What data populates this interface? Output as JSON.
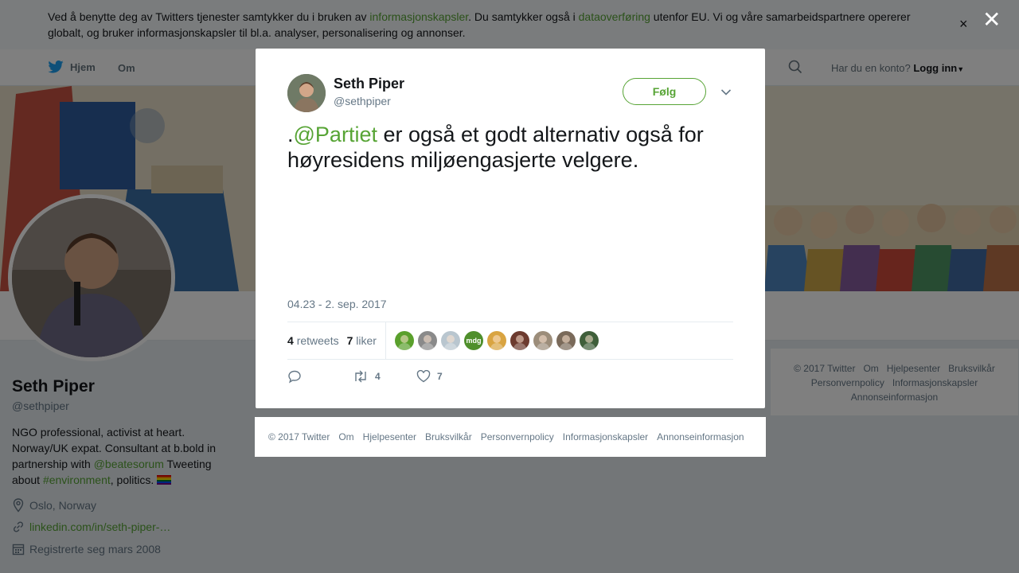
{
  "cookie": {
    "text_1": "Ved å benytte deg av Twitters tjenester samtykker du i bruken av ",
    "link_1": "informasjonskapsler",
    "text_2": ". Du samtykker også i ",
    "link_2": "dataoverføring",
    "text_3": " utenfor EU. Vi og våre samarbeidspartnere opererer globalt, og bruker informasjonskapsler til bl.a. analyser, personalisering og annonser.",
    "close": "×"
  },
  "nav": {
    "home": "Hjem",
    "about": "Om",
    "login_prompt": "Har du en konto?",
    "login": "Logg inn"
  },
  "profile": {
    "name": "Seth Piper",
    "handle": "@sethpiper",
    "bio_1": "NGO professional, activist at heart. Norway/UK expat. Consultant at b.bold in partnership with ",
    "bio_mention": "@beatesorum",
    "bio_2": " Tweeting about ",
    "bio_hashtag": "#environment",
    "bio_3": ", politics. ",
    "location": "Oslo, Norway",
    "website": "linkedin.com/in/seth-piper-…",
    "joined": "Registrerte seg mars 2008"
  },
  "bg_footer": {
    "items": [
      "© 2017 Twitter",
      "Om",
      "Hjelpesenter",
      "Bruksvilkår",
      "Personvernpolicy",
      "Informasjonskapsler",
      "Annonseinformasjon"
    ]
  },
  "overlay": {
    "close": "✕"
  },
  "tweet": {
    "name": "Seth Piper",
    "handle": "@sethpiper",
    "follow": "Følg",
    "text_prefix": ".",
    "mention": "@Partiet",
    "text_body": " er også et godt alternativ også for høyresidens miljøengasjerte velgere.",
    "timestamp": "04.23 - 2. sep. 2017",
    "retweets_count": "4",
    "retweets_label": "retweets",
    "likes_count": "7",
    "likes_label": "liker",
    "reply_count": "",
    "retweet_action_count": "4",
    "like_action_count": "7",
    "liker_colors": [
      "#5aa02c",
      "#8a8a8a",
      "#b9c6cf",
      "#4f8f2c",
      "#d9a441",
      "#6d3b2f",
      "#9c8d7a",
      "#7a6a5a",
      "#3f5f3a"
    ],
    "liker_labels": [
      "",
      "",
      "",
      "mdg",
      "",
      "",
      "",
      "",
      ""
    ]
  },
  "modal_footer": {
    "items": [
      "© 2017 Twitter",
      "Om",
      "Hjelpesenter",
      "Bruksvilkår",
      "Personvernpolicy",
      "Informasjonskapsler",
      "Annonseinformasjon"
    ]
  },
  "colors": {
    "accent": "#57a435",
    "overlay": "rgba(0,0,0,0.5)"
  }
}
